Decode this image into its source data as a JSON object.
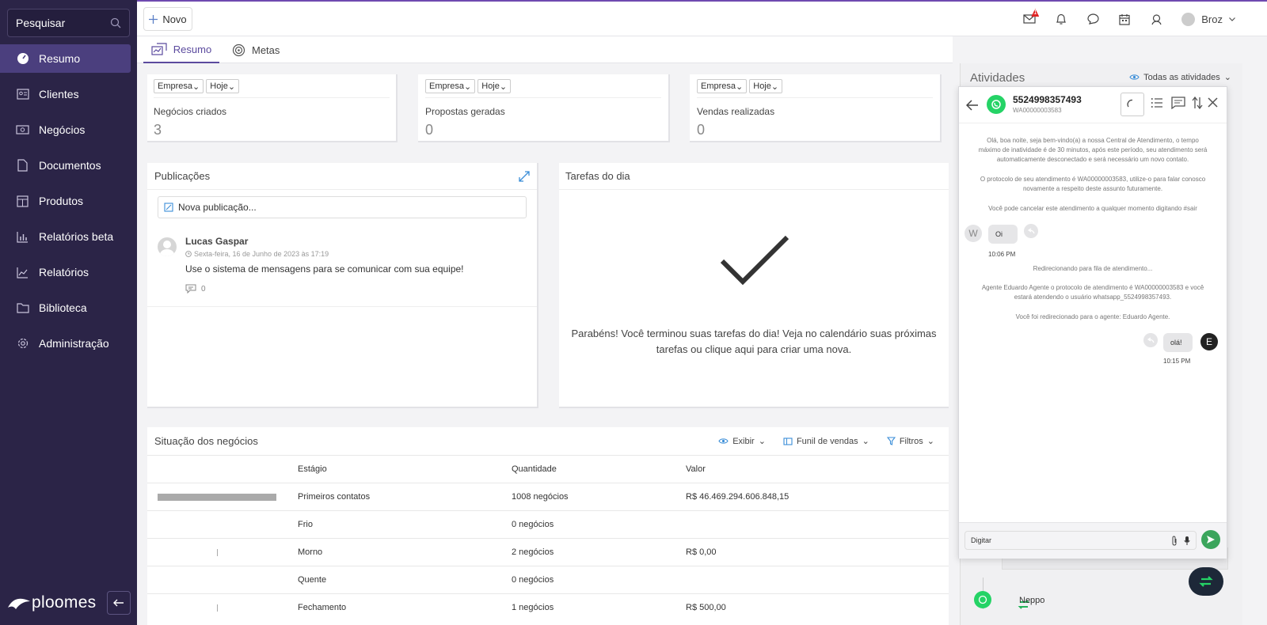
{
  "sidebar": {
    "search_label": "Pesquisar",
    "items": [
      {
        "label": "Resumo",
        "icon": "dashboard-icon",
        "active": true
      },
      {
        "label": "Clientes",
        "icon": "contacts-icon"
      },
      {
        "label": "Negócios",
        "icon": "money-icon"
      },
      {
        "label": "Documentos",
        "icon": "document-icon"
      },
      {
        "label": "Produtos",
        "icon": "box-icon"
      },
      {
        "label": "Relatórios beta",
        "icon": "bar-chart-icon"
      },
      {
        "label": "Relatórios",
        "icon": "line-chart-icon"
      },
      {
        "label": "Biblioteca",
        "icon": "folder-icon"
      },
      {
        "label": "Administração",
        "icon": "gear-icon"
      }
    ],
    "logo_text": "ploomes"
  },
  "topbar": {
    "new_label": "Novo",
    "user_name": "Broz",
    "mail_badge": "1"
  },
  "tabs": [
    {
      "label": "Resumo",
      "active": true
    },
    {
      "label": "Metas"
    }
  ],
  "kpis": [
    {
      "filter1": "Empresa",
      "filter2": "Hoje",
      "label": "Negócios criados",
      "value": "3"
    },
    {
      "filter1": "Empresa",
      "filter2": "Hoje",
      "label": "Propostas geradas",
      "value": "0"
    },
    {
      "filter1": "Empresa",
      "filter2": "Hoje",
      "label": "Vendas realizadas",
      "value": "0"
    }
  ],
  "publications": {
    "title": "Publicações",
    "new_placeholder": "Nova publicação...",
    "post": {
      "author": "Lucas Gaspar",
      "date": "Sexta-feira, 16 de Junho de 2023 às 17:19",
      "text": "Use o sistema de mensagens para se comunicar com sua equipe!",
      "comments": "0"
    }
  },
  "tasks": {
    "title": "Tarefas do dia",
    "message_line1": "Parabéns! Você terminou suas tarefas do dia! Veja no calendário suas próximas",
    "message_line2": "tarefas ou clique aqui para criar uma nova."
  },
  "deals": {
    "title": "Situação dos negócios",
    "show_label": "Exibir",
    "funnel_label": "Funil de vendas",
    "filters_label": "Filtros",
    "headers": {
      "stage": "Estágio",
      "qty": "Quantidade",
      "value": "Valor"
    },
    "rows": [
      {
        "stage": "Primeiros contatos",
        "qty": "1008 negócios",
        "value": "R$ 46.469.294.606.848,15",
        "bar": 1.0
      },
      {
        "stage": "Frio",
        "qty": "0 negócios",
        "value": "",
        "bar": 0
      },
      {
        "stage": "Morno",
        "qty": "2 negócios",
        "value": "R$ 0,00",
        "bar": 0.002
      },
      {
        "stage": "Quente",
        "qty": "0 negócios",
        "value": "",
        "bar": 0
      },
      {
        "stage": "Fechamento",
        "qty": "1 negócios",
        "value": "R$ 500,00",
        "bar": 0.001
      }
    ]
  },
  "activities": {
    "title": "Atividades",
    "filter_label": "Todas as atividades",
    "bottom_item": "Neppo"
  },
  "chat": {
    "phone": "5524998357493",
    "protocol": "WA00000003583",
    "sys1_l1": "Olá, boa noite, seja bem-vindo(a) a nossa Central de Atendimento, o tempo",
    "sys1_l2": "máximo de inatividade é de 30 minutos, após este período, seu atendimento será",
    "sys1_l3": "automaticamente desconectado e será necessário um novo contato.",
    "sys2_l1": "O protocolo de seu atendimento é WA00000003583, utilize-o para falar conosco",
    "sys2_l2": "novamente a respeito deste assunto futuramente.",
    "sys3": "Você pode cancelar este atendimento a qualquer momento digitando #sair",
    "msg_in": "Oi",
    "msg_in_initial": "W",
    "msg_in_time": "10:06 PM",
    "sys4": "Redirecionando para fila de atendimento...",
    "sys5_l1": "Agente Eduardo Agente o protocolo de atendimento é WA00000003583 e você",
    "sys5_l2": "estará atendendo o usuário whatsapp_5524998357493.",
    "sys6": "Você foi redirecionado para o agente: Eduardo Agente.",
    "msg_out": "olá!",
    "msg_out_initial": "E",
    "msg_out_time": "10:15 PM",
    "input_value": "Digitar"
  },
  "colors": {
    "sidebar": "#2b2447",
    "accent": "#5b4a9e",
    "whatsapp": "#25d366",
    "send": "#3ba55c"
  }
}
